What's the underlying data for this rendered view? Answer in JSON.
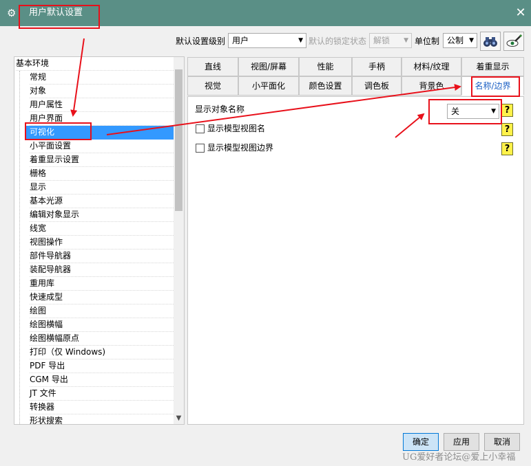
{
  "window": {
    "title": "用户默认设置",
    "close_glyph": "✕",
    "gear_glyph": "⚙"
  },
  "toolbar": {
    "level_label": "默认设置级别",
    "level_value": "用户",
    "lock_label": "默认的锁定状态",
    "lock_value": "解锁",
    "unit_label": "单位制",
    "unit_value": "公制",
    "find_icon": "binoculars-icon",
    "manage_icon": "eye-pen-icon"
  },
  "tree": {
    "root": "基本环境",
    "items": [
      "常规",
      "对象",
      "用户属性",
      "用户界面",
      "可视化",
      "小平面设置",
      "着重显示设置",
      "栅格",
      "显示",
      "基本光源",
      "编辑对象显示",
      "线宽",
      "视图操作",
      "部件导航器",
      "装配导航器",
      "重用库",
      "快速成型",
      "绘图",
      "绘图横幅",
      "绘图横幅原点",
      "打印（仅 Windows)",
      "PDF 导出",
      "CGM 导出",
      "JT 文件",
      "转换器",
      "形状搜索"
    ],
    "selected_index": 4
  },
  "tabs": {
    "row1": [
      "直线",
      "视图/屏幕",
      "性能",
      "手柄",
      "材料/纹理",
      "着重显示"
    ],
    "row2": [
      "视觉",
      "小平面化",
      "颜色设置",
      "调色板",
      "背景色",
      "名称/边界"
    ],
    "active": "名称/边界"
  },
  "panel": {
    "show_name_label": "显示对象名称",
    "show_name_value": "关",
    "checkbox1_label": "显示模型视图名",
    "checkbox1_checked": false,
    "checkbox2_label": "显示模型视图边界",
    "checkbox2_checked": false,
    "help_glyph": "?"
  },
  "buttons": {
    "ok": "确定",
    "apply": "应用",
    "cancel": "取消"
  },
  "watermark": "UG爱好者论坛@爱上小幸福",
  "colors": {
    "titlebar": "#5a8f86",
    "selection": "#3399ff",
    "annotation": "#e8101a",
    "primary_button": "#cce4f7"
  }
}
